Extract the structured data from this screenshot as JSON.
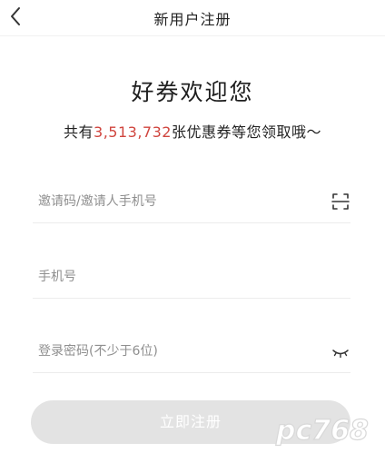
{
  "header": {
    "back_icon": "chevron-left-icon",
    "title": "新用户注册"
  },
  "welcome": {
    "title": "好券欢迎您",
    "subtitle_prefix": "共有",
    "coupon_count": "3,513,732",
    "subtitle_suffix": "张优惠券等您领取哦～"
  },
  "form": {
    "invite": {
      "placeholder": "邀请码/邀请人手机号",
      "value": "",
      "icon": "scan-icon"
    },
    "phone": {
      "placeholder": "手机号",
      "value": ""
    },
    "password": {
      "placeholder": "登录密码(不少于6位)",
      "value": "",
      "icon": "eye-closed-icon"
    },
    "submit_label": "立即注册"
  },
  "watermark": {
    "text": "pc768",
    "icon": "watermark-logo"
  },
  "colors": {
    "accent": "#d0453e",
    "button_disabled": "#e3e3e3",
    "divider": "#ececec"
  }
}
